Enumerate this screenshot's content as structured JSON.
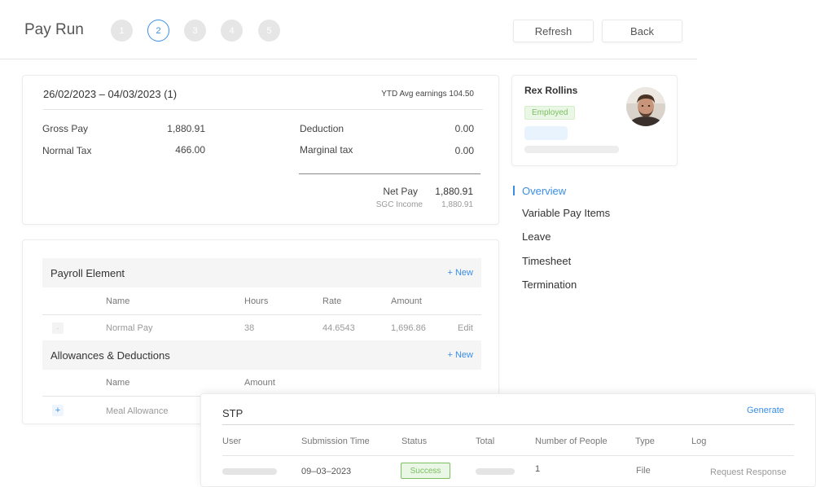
{
  "header": {
    "title": "Pay Run",
    "steps": [
      "1",
      "2",
      "3",
      "4",
      "5"
    ],
    "active_step": 2,
    "refresh_label": "Refresh",
    "back_label": "Back"
  },
  "summary": {
    "period": "26/02/2023 – 04/03/2023 (1)",
    "ytd": "YTD Avg earnings 104.50",
    "gross_pay_label": "Gross Pay",
    "gross_pay_value": "1,880.91",
    "normal_tax_label": "Normal Tax",
    "normal_tax_value": "466.00",
    "deduction_label": "Deduction",
    "deduction_value": "0.00",
    "marginal_tax_label": "Marginal tax",
    "marginal_tax_value": "0.00",
    "net_pay_label": "Net Pay",
    "net_pay_value": "1,880.91",
    "sgc_label": "SGC Income",
    "sgc_value": "1,880.91"
  },
  "payroll": {
    "title": "Payroll Element",
    "new_label": "+ New",
    "columns": [
      "Name",
      "Hours",
      "Rate",
      "Amount"
    ],
    "rows": [
      {
        "icon": "·",
        "name": "Normal Pay",
        "hours": "38",
        "rate": "44.6543",
        "amount": "1,696.86",
        "action": "Edit"
      }
    ]
  },
  "allowances": {
    "title": "Allowances & Deductions",
    "new_label": "+ New",
    "columns": [
      "Name",
      "Amount"
    ],
    "rows": [
      {
        "icon": "+",
        "name": "Meal Allowance"
      }
    ]
  },
  "profile": {
    "name": "Rex Rollins",
    "status": "Employed"
  },
  "nav": {
    "items": [
      "Overview",
      "Variable Pay Items",
      "Leave",
      "Timesheet",
      "Termination"
    ],
    "active": "Overview"
  },
  "stp": {
    "title": "STP",
    "generate_label": "Generate",
    "columns": [
      "User",
      "Submission Time",
      "Status",
      "Total",
      "Number of People",
      "Type",
      "Log"
    ],
    "row": {
      "submission_time": "09–03–2023",
      "status": "Success",
      "people": "1",
      "type": "File",
      "log": "Request Response"
    }
  },
  "colors": {
    "accent": "#3a8ee6",
    "success": "#7cbf60",
    "muted_text": "#999999"
  }
}
